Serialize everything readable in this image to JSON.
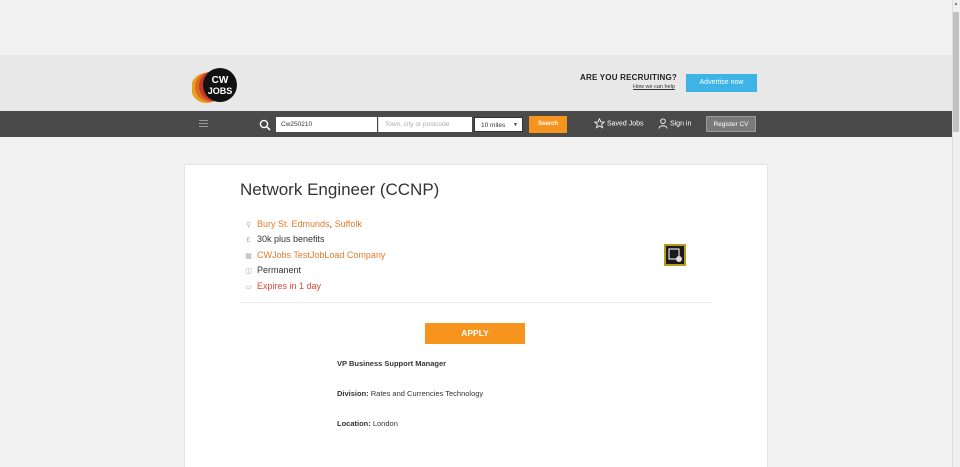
{
  "header": {
    "logo_text_top": "CW",
    "logo_text_bottom": "JOBS",
    "recruit_heading": "ARE YOU RECRUITING?",
    "recruit_link": "How we can help",
    "advertise_label": "Advertise now"
  },
  "nav": {
    "keyword_value": "Cw250210",
    "location_placeholder": "Town, city or postcode",
    "radius_value": "10 miles",
    "search_label": "Search",
    "saved_jobs_label": "Saved Jobs",
    "sign_in_label": "Sign in",
    "register_label": "Register CV"
  },
  "job": {
    "title": "Network Engineer (CCNP)",
    "location_town": "Bury St. Edmunds",
    "location_sep": ", ",
    "location_county": "Suffolk",
    "salary": "30k plus benefits",
    "company": "CWJobs TestJobLoad Company",
    "job_type": "Permanent",
    "expiry": "Expires in 1 day",
    "apply_label": "APPLY",
    "role_heading": "VP Business Support Manager",
    "division_label": "Division:",
    "division_value": " Rates and Currencies Technology",
    "location_label": "Location:",
    "location_value": " London"
  },
  "colors": {
    "accent": "#f7941d",
    "link": "#e07b2a",
    "alert": "#e0463a",
    "navbar": "#4a4a4a",
    "advertise": "#3db4e5"
  },
  "icons": [
    "menu-icon",
    "search-icon",
    "star-icon",
    "user-icon",
    "map-pin-icon",
    "pound-icon",
    "building-icon",
    "briefcase-icon",
    "calendar-icon"
  ]
}
